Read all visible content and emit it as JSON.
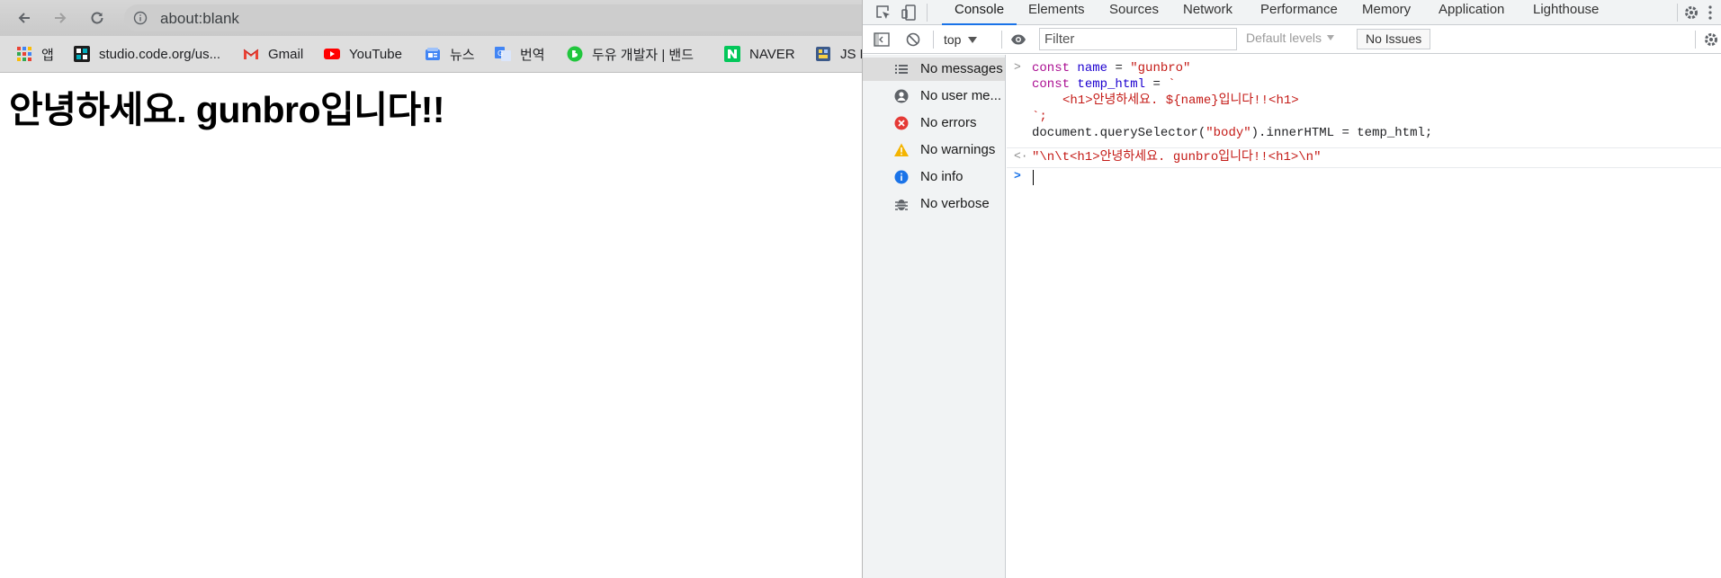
{
  "browser": {
    "url": "about:blank",
    "bookmarks": [
      {
        "label": "앱",
        "icon": "apps-grid-icon"
      },
      {
        "label": "studio.code.org/us...",
        "icon": "code-org-icon"
      },
      {
        "label": "Gmail",
        "icon": "gmail-icon"
      },
      {
        "label": "YouTube",
        "icon": "youtube-icon"
      },
      {
        "label": "뉴스",
        "icon": "news-icon"
      },
      {
        "label": "번역",
        "icon": "translate-icon"
      },
      {
        "label": "두유 개발자 | 밴드",
        "icon": "band-icon"
      },
      {
        "label": "NAVER",
        "icon": "naver-icon"
      },
      {
        "label": "JS E",
        "icon": "bookmark-site-icon"
      }
    ],
    "page_heading": "안녕하세요. gunbro입니다!!"
  },
  "devtools": {
    "tabs": [
      "Console",
      "Elements",
      "Sources",
      "Network",
      "Performance",
      "Memory",
      "Application",
      "Lighthouse"
    ],
    "active_tab": "Console",
    "context": "top",
    "filter_placeholder": "Filter",
    "levels_label": "Default levels",
    "issues_label": "No Issues",
    "sidebar": [
      {
        "label": "No messages",
        "icon": "list-icon"
      },
      {
        "label": "No user me...",
        "icon": "user-icon"
      },
      {
        "label": "No errors",
        "icon": "error-icon"
      },
      {
        "label": "No warnings",
        "icon": "warning-icon"
      },
      {
        "label": "No info",
        "icon": "info-icon"
      },
      {
        "label": "No verbose",
        "icon": "bug-icon"
      }
    ],
    "console": {
      "code": {
        "kw_const": "const",
        "name_var": "name",
        "name_val": "\"gunbro\"",
        "temp_var": "temp_html",
        "backtick_open": "`",
        "template_line": "<h1>안녕하세요. ${name}입니다!!<h1>",
        "backtick_close": "`;",
        "qs_before": "document.querySelector(",
        "qs_arg": "\"body\"",
        "qs_after": ").innerHTML = temp_html;"
      },
      "result": "\"\\n\\t<h1>안녕하세요. gunbro입니다!!<h1>\\n\""
    }
  },
  "colors": {
    "accent": "#1a73e8",
    "keyword": "#aa0d91",
    "string": "#c41a16"
  }
}
